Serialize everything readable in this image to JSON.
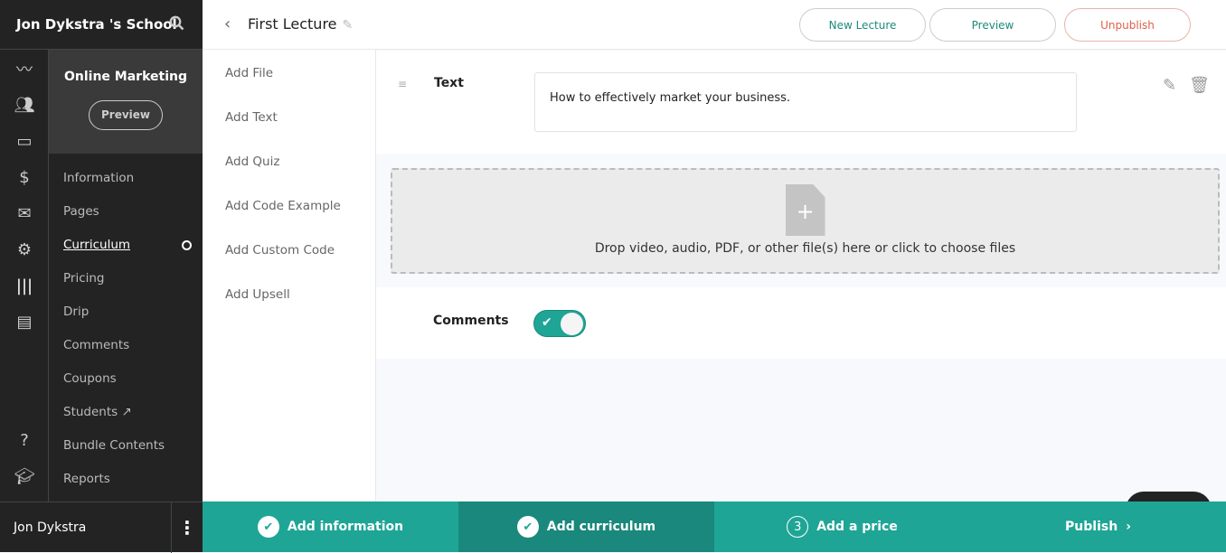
{
  "school": {
    "name": "Jon Dykstra 's School"
  },
  "course": {
    "title": "Online Marketing",
    "preview_label": "Preview"
  },
  "nav": {
    "items": [
      {
        "label": "Information"
      },
      {
        "label": "Pages"
      },
      {
        "label": "Curriculum"
      },
      {
        "label": "Pricing"
      },
      {
        "label": "Drip"
      },
      {
        "label": "Comments"
      },
      {
        "label": "Coupons"
      },
      {
        "label": "Students"
      },
      {
        "label": "Bundle Contents"
      },
      {
        "label": "Reports"
      }
    ]
  },
  "user": {
    "name": "Jon Dykstra"
  },
  "header": {
    "title": "First Lecture",
    "new_lecture": "New Lecture",
    "preview": "Preview",
    "unpublish": "Unpublish"
  },
  "add_panel": {
    "items": [
      {
        "label": "Add File"
      },
      {
        "label": "Add Text"
      },
      {
        "label": "Add Quiz"
      },
      {
        "label": "Add Code Example"
      },
      {
        "label": "Add Custom Code"
      },
      {
        "label": "Add Upsell"
      }
    ]
  },
  "text_block": {
    "label": "Text",
    "content": "How to effectively market your business."
  },
  "dropzone": {
    "message": "Drop video, audio, PDF, or other file(s) here or click to choose files"
  },
  "comments": {
    "label": "Comments",
    "enabled": true
  },
  "steps": [
    {
      "label": "Add information",
      "mark": "✔"
    },
    {
      "label": "Add curriculum",
      "mark": "✔"
    },
    {
      "label": "Add a price",
      "mark": "3"
    },
    {
      "label": "Publish"
    }
  ],
  "colors": {
    "accent": "#1fa596",
    "danger": "#e0604a"
  }
}
